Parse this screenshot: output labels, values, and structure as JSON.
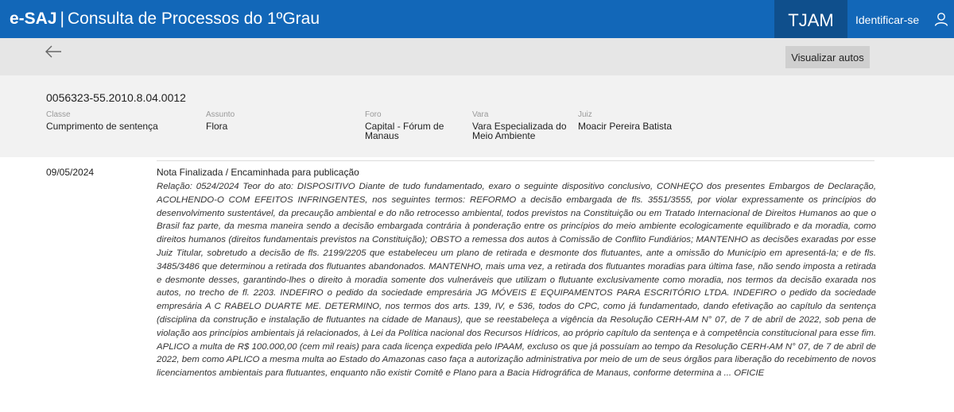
{
  "header": {
    "brand": "e-SAJ",
    "separator": "|",
    "title": "Consulta de Processos do 1ºGrau",
    "court": "TJAM",
    "identify_label": "Identificar-se"
  },
  "toolbar": {
    "back_icon": "arrow-left-icon",
    "view_button": "Visualizar autos"
  },
  "process": {
    "number": "0056323-55.2010.8.04.0012",
    "fields": {
      "classe": {
        "label": "Classe",
        "value": "Cumprimento de sentença"
      },
      "assunto": {
        "label": "Assunto",
        "value": "Flora"
      },
      "foro": {
        "label": "Foro",
        "value": "Capital - Fórum de Manaus"
      },
      "vara": {
        "label": "Vara",
        "value": "Vara Especializada do Meio Ambiente"
      },
      "juiz": {
        "label": "Juiz",
        "value": "Moacir Pereira Batista"
      }
    }
  },
  "movement": {
    "date": "09/05/2024",
    "title": "Nota Finalizada / Encaminhada para publicação",
    "text": "Relação: 0524/2024 Teor do ato: DISPOSITIVO Diante de tudo fundamentado, exaro o seguinte dispositivo conclusivo, CONHEÇO dos presentes Embargos de Declaração, ACOLHENDO-O COM EFEITOS INFRINGENTES, nos seguintes termos: REFORMO a decisão embargada de fls. 3551/3555, por violar expressamente os princípios do desenvolvimento sustentável, da precaução ambiental e do não retrocesso ambiental, todos previstos na Constituição ou em Tratado Internacional de Direitos Humanos ao que o Brasil faz parte, da mesma maneira sendo a decisão embargada contrária à ponderação entre os princípios do meio ambiente ecologicamente equilibrado e da moradia, como direitos humanos (direitos fundamentais previstos na Constituição); OBSTO a remessa dos autos à Comissão de Conflito Fundiários; MANTENHO as decisões exaradas por esse Juiz Titular, sobretudo a decisão de fls. 2199/2205 que estabeleceu um plano de retirada e desmonte dos flutuantes, ante a omissão do Município em apresentá-la; e de fls. 3485/3486 que determinou a retirada dos flutuantes abandonados. MANTENHO, mais uma vez, a retirada dos flutuantes moradias para última fase, não sendo imposta a retirada e desmonte desses, garantindo-lhes o direito à moradia somente dos vulneráveis que utilizam o flutuante exclusivamente como moradia, nos termos da decisão exarada nos autos, no trecho de fl. 2203. INDEFIRO o pedido da sociedade empresária JG MÓVEIS E EQUIPAMENTOS PARA ESCRITÓRIO LTDA. INDEFIRO o pedido da sociedade empresária A C RABELO DUARTE ME. DETERMINO, nos termos dos arts. 139, IV, e 536, todos do CPC, como já fundamentado, dando efetivação ao capítulo da sentença (disciplina da construção e instalação de flutuantes na cidade de Manaus), que se reestabeleça a vigência da Resolução CERH-AM N° 07, de 7 de abril de 2022, sob pena de violação aos princípios ambientais já relacionados, à Lei da Política nacional dos Recursos Hídricos, ao próprio capítulo da sentença e à competência constitucional para esse fim. APLICO a multa de R$ 100.000,00 (cem mil reais) para cada licença expedida pelo IPAAM, excluso os que já possuíam ao tempo da Resolução CERH-AM N° 07, de 7 de abril de 2022, bem como APLICO a mesma multa ao Estado do Amazonas caso faça a autorização administrativa por meio de um de seus órgãos para liberação do recebimento de novos licenciamentos ambientais para flutuantes, enquanto não existir Comitê e Plano para a Bacia Hidrográfica de Manaus, conforme determina a ... OFICIE"
  }
}
